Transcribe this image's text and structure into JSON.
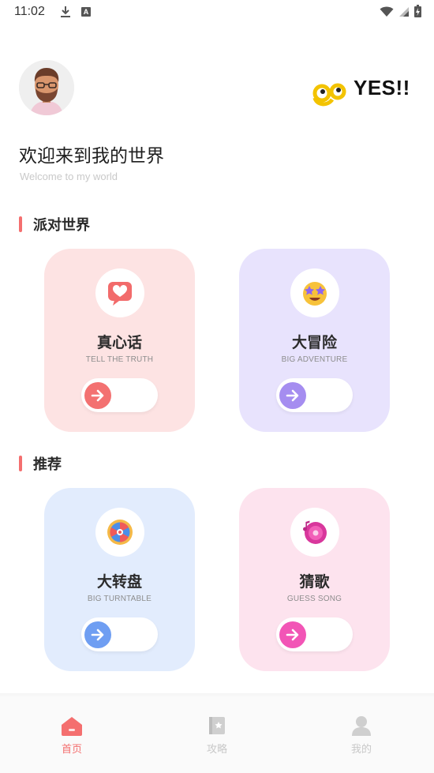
{
  "status_bar": {
    "time": "11:02",
    "a_badge": "A"
  },
  "header": {
    "logo_text": "YES!!",
    "welcome": "欢迎来到我的世界",
    "welcome_sub": "Welcome to my world"
  },
  "sections": [
    {
      "title": "派对世界",
      "cards": [
        {
          "title": "真心话",
          "subtitle": "TELL THE TRUTH",
          "icon": "heart-chat-icon",
          "bg": "#fde3e3",
          "accent": "#f37171"
        },
        {
          "title": "大冒险",
          "subtitle": "BIG ADVENTURE",
          "icon": "star-eyes-emoji-icon",
          "bg": "#e8e3fd",
          "accent": "#a58df0"
        }
      ]
    },
    {
      "title": "推荐",
      "cards": [
        {
          "title": "大转盘",
          "subtitle": "BIG TURNTABLE",
          "icon": "wheel-icon",
          "bg": "#e2ecfd",
          "accent": "#6f9ef2"
        },
        {
          "title": "猜歌",
          "subtitle": "GUESS SONG",
          "icon": "music-disc-icon",
          "bg": "#fde3ee",
          "accent": "#f255b6"
        }
      ]
    }
  ],
  "bottom_nav": [
    {
      "label": "首页",
      "icon": "home-icon",
      "active": true
    },
    {
      "label": "攻略",
      "icon": "guide-book-icon",
      "active": false
    },
    {
      "label": "我的",
      "icon": "profile-icon",
      "active": false
    }
  ],
  "colors": {
    "accent": "#f46f6f",
    "inactive": "#c8c8c8"
  }
}
